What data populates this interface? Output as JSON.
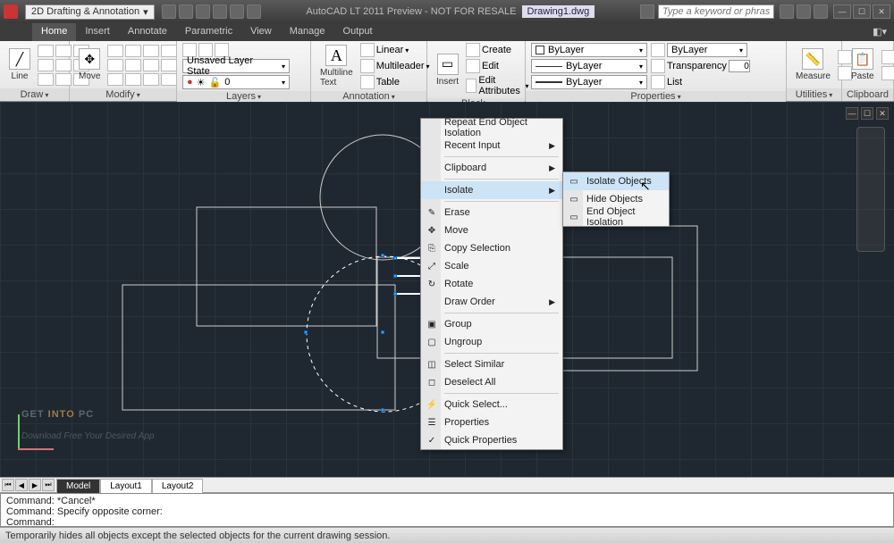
{
  "titlebar": {
    "workspace": "2D Drafting & Annotation",
    "app_title": "AutoCAD LT 2011 Preview - NOT FOR RESALE",
    "doc": "Drawing1.dwg",
    "search_placeholder": "Type a keyword or phrase"
  },
  "tabs": [
    "Home",
    "Insert",
    "Annotate",
    "Parametric",
    "View",
    "Manage",
    "Output"
  ],
  "active_tab": 0,
  "ribbon": {
    "draw": {
      "label": "Draw",
      "line": "Line"
    },
    "modify": {
      "label": "Modify",
      "move": "Move"
    },
    "layers": {
      "label": "Layers",
      "state": "Unsaved Layer State",
      "current": "0"
    },
    "annotation": {
      "label": "Annotation",
      "mtext": "Multiline Text",
      "linear": "Linear",
      "multileader": "Multileader",
      "table": "Table"
    },
    "block": {
      "label": "Block",
      "insert": "Insert",
      "create": "Create",
      "edit": "Edit",
      "editattr": "Edit Attributes"
    },
    "properties": {
      "label": "Properties",
      "bylayer": "ByLayer",
      "transparency": "Transparency",
      "tvalue": "0",
      "list": "List"
    },
    "utilities": {
      "label": "Utilities",
      "measure": "Measure"
    },
    "clipboard": {
      "label": "Clipboard",
      "paste": "Paste"
    }
  },
  "context_menu": {
    "items": [
      {
        "label": "Repeat End Object Isolation",
        "sub": false
      },
      {
        "label": "Recent Input",
        "sub": true
      },
      {
        "sep": true
      },
      {
        "label": "Clipboard",
        "sub": true
      },
      {
        "sep": true
      },
      {
        "label": "Isolate",
        "sub": true,
        "hover": true
      },
      {
        "sep": true
      },
      {
        "label": "Erase",
        "icon": "✎"
      },
      {
        "label": "Move",
        "icon": "✥"
      },
      {
        "label": "Copy Selection",
        "icon": "⎘"
      },
      {
        "label": "Scale",
        "icon": "⤢"
      },
      {
        "label": "Rotate",
        "icon": "↻"
      },
      {
        "label": "Draw Order",
        "sub": true
      },
      {
        "sep": true
      },
      {
        "label": "Group",
        "icon": "▣"
      },
      {
        "label": "Ungroup",
        "icon": "▢"
      },
      {
        "sep": true
      },
      {
        "label": "Select Similar",
        "icon": "◫"
      },
      {
        "label": "Deselect All",
        "icon": "◻"
      },
      {
        "sep": true
      },
      {
        "label": "Quick Select...",
        "icon": "⚡"
      },
      {
        "label": "Properties",
        "icon": "☰"
      },
      {
        "label": "Quick Properties",
        "icon": "✓"
      }
    ],
    "submenu": [
      {
        "label": "Isolate Objects",
        "hover": true
      },
      {
        "label": "Hide Objects"
      },
      {
        "label": "End Object Isolation"
      }
    ]
  },
  "modeltabs": [
    "Model",
    "Layout1",
    "Layout2"
  ],
  "active_modeltab": 0,
  "command": {
    "line1": "Command: *Cancel*",
    "line2": "Command: Specify opposite corner:",
    "line3": "Command:"
  },
  "statusbar": "Temporarily hides all objects except the selected objects for the current drawing session.",
  "watermark": {
    "p1": "GET ",
    "p2": "INTO ",
    "p3": "PC",
    "sub": "Download Free Your Desired App"
  }
}
